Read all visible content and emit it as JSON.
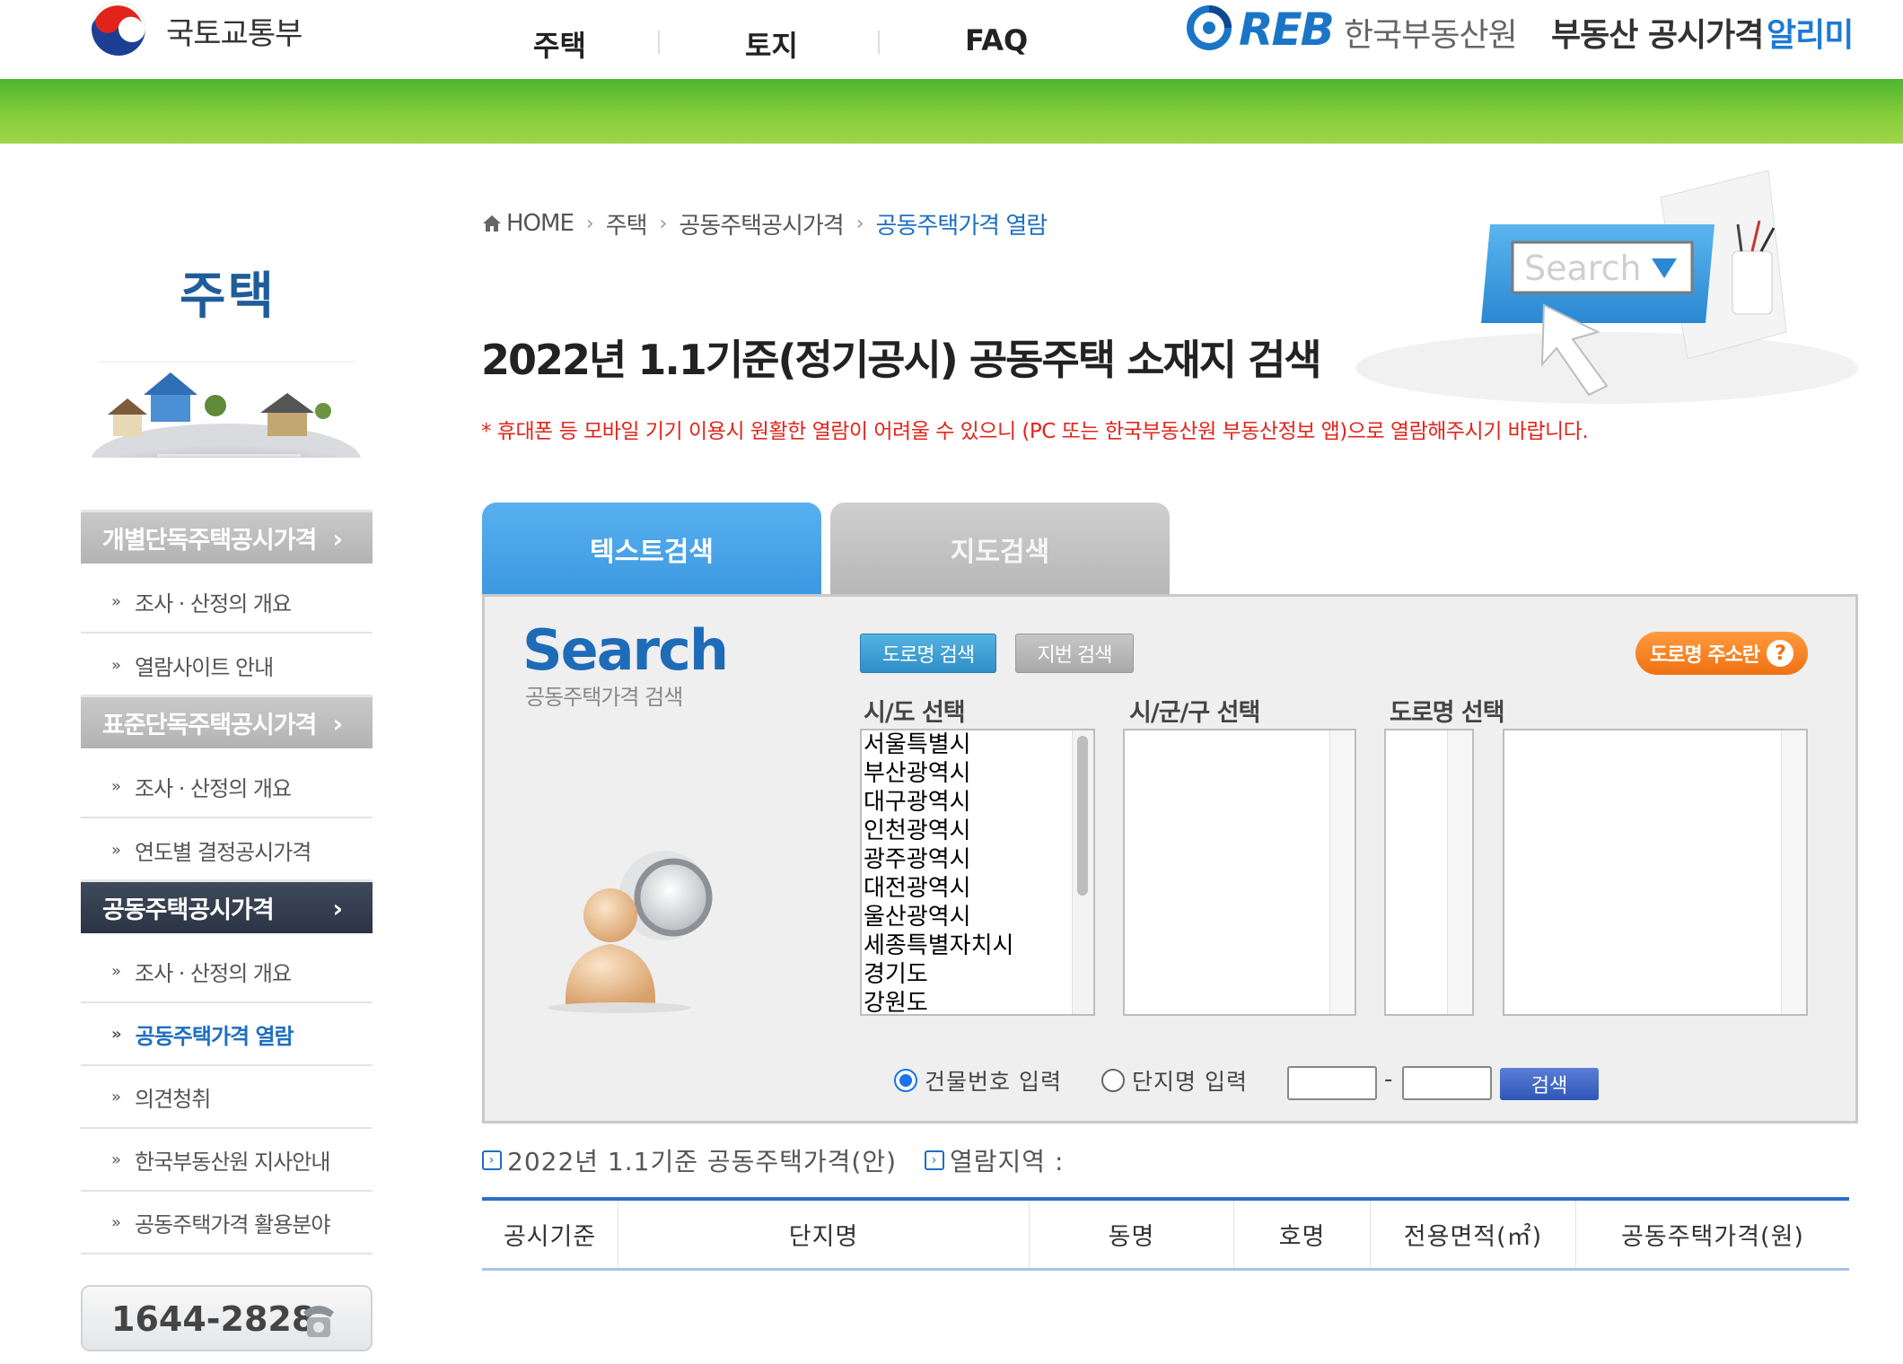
{
  "header": {
    "ministry_name": "국토교통부",
    "nav": [
      "주택",
      "토지",
      "FAQ"
    ],
    "reb_logo_text": "REB",
    "reb_org": "한국부동산원",
    "reb_service": "부동산 공시가격",
    "reb_service_accent": "알리미"
  },
  "sidebar": {
    "title": "주택",
    "groups": [
      {
        "label": "개별단독주택공시가격",
        "chevron": "›",
        "active": false,
        "items": [
          "조사 · 산정의 개요",
          "열람사이트 안내"
        ]
      },
      {
        "label": "표준단독주택공시가격",
        "chevron": "›",
        "active": false,
        "items": [
          "조사 · 산정의 개요",
          "연도별 결정공시가격"
        ]
      },
      {
        "label": "공동주택공시가격",
        "chevron": "›",
        "active": true,
        "items": [
          "조사 · 산정의 개요",
          "공동주택가격 열람",
          "의견청취",
          "한국부동산원 지사안내",
          "공동주택가격 활용분야"
        ]
      }
    ],
    "bullet": "»",
    "current_item": "공동주택가격 열람",
    "phone": "1644-2828"
  },
  "breadcrumb": [
    "HOME",
    "주택",
    "공동주택공시가격",
    "공동주택가격 열람"
  ],
  "breadcrumb_sep": "›",
  "page_title": "2022년 1.1기준(정기공시) 공동주택 소재지 검색",
  "notice": "* 휴대폰 등 모바일 기기 이용시 원활한 열람이 어려울 수 있으니 (PC 또는 한국부동산원 부동산정보 앱)으로 열람해주시기 바랍니다.",
  "hero_search_text": "Search",
  "tabs": [
    "텍스트검색",
    "지도검색"
  ],
  "search_panel": {
    "heading": "Search",
    "subheading": "공동주택가격 검색",
    "mode_buttons": [
      "도로명 검색",
      "지번 검색"
    ],
    "guide_button": "도로명 주소란",
    "guide_icon": "?",
    "labels": {
      "sido": "시/도 선택",
      "sigungu": "시/군/구 선택",
      "road": "도로명 선택"
    },
    "sido_options": [
      "서울특별시",
      "부산광역시",
      "대구광역시",
      "인천광역시",
      "광주광역시",
      "대전광역시",
      "울산광역시",
      "세종특별자치시",
      "경기도",
      "강원도"
    ],
    "radios": [
      {
        "label": "건물번호 입력",
        "checked": true
      },
      {
        "label": "단지명 입력",
        "checked": false
      }
    ],
    "number_dash": "-",
    "search_button": "검색"
  },
  "results": {
    "base_info": "2022년 1.1기준 공동주택가격(안)",
    "region_info": "열람지역 :",
    "info_icon": "›",
    "columns": [
      "공시기준",
      "단지명",
      "동명",
      "호명",
      "전용면적(㎡)",
      "공동주택가격(원)"
    ]
  },
  "colors": {
    "green_band": "#6cc437",
    "brand_blue": "#1f6fc2",
    "active_tab": "#4aa6ea",
    "notice_red": "#e3241b",
    "guide_orange": "#f07012"
  }
}
